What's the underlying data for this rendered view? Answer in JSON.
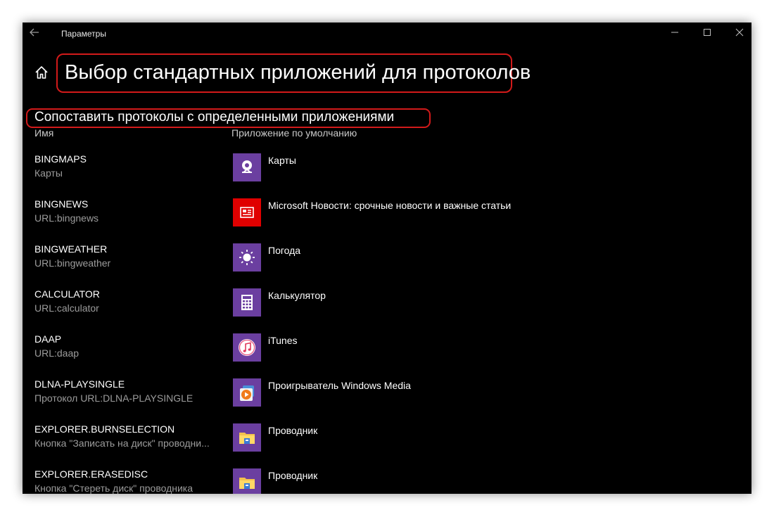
{
  "window": {
    "title": "Параметры",
    "back_icon": "back-arrow-icon",
    "controls": [
      "minimize-icon",
      "maximize-icon",
      "close-icon"
    ]
  },
  "page": {
    "home_icon": "home-icon",
    "title": "Выбор стандартных приложений для протоколов",
    "section_title": "Сопоставить протоколы с определенными приложениями",
    "col_name": "Имя",
    "col_app": "Приложение по умолчанию"
  },
  "highlight_color": "#d21a1a",
  "rows": [
    {
      "name": "BINGMAPS",
      "desc": "Карты",
      "app": "Карты",
      "icon": "maps-icon",
      "tile_color": "#6b3fa0"
    },
    {
      "name": "BINGNEWS",
      "desc": "URL:bingnews",
      "app": "Microsoft Новости: срочные новости и важные статьи",
      "icon": "news-icon",
      "tile_color": "#e00000"
    },
    {
      "name": "BINGWEATHER",
      "desc": "URL:bingweather",
      "app": "Погода",
      "icon": "weather-sun-icon",
      "tile_color": "#6b3fa0"
    },
    {
      "name": "CALCULATOR",
      "desc": "URL:calculator",
      "app": "Калькулятор",
      "icon": "calculator-icon",
      "tile_color": "#6b3fa0"
    },
    {
      "name": "DAAP",
      "desc": "URL:daap",
      "app": "iTunes",
      "icon": "itunes-icon",
      "tile_color": "#6b3fa0"
    },
    {
      "name": "DLNA-PLAYSINGLE",
      "desc": "Протокол URL:DLNA-PLAYSINGLE",
      "app": "Проигрыватель Windows Media",
      "icon": "windows-media-player-icon",
      "tile_color": "#6b3fa0"
    },
    {
      "name": "EXPLORER.BURNSELECTION",
      "desc": "Кнопка \"Записать на диск\" проводни...",
      "app": "Проводник",
      "icon": "file-explorer-icon",
      "tile_color": "#6b3fa0"
    },
    {
      "name": "EXPLORER.ERASEDISC",
      "desc": "Кнопка \"Стереть диск\" проводника",
      "app": "Проводник",
      "icon": "file-explorer-icon",
      "tile_color": "#6b3fa0"
    }
  ]
}
